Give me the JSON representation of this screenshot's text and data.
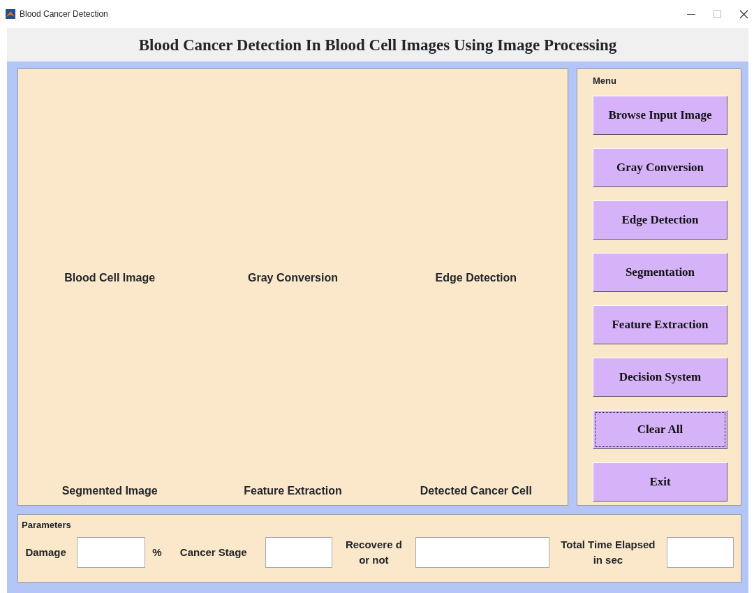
{
  "window": {
    "title": "Blood Cancer Detection"
  },
  "heading": "Blood Cancer Detection In Blood Cell Images Using Image Processing",
  "image_labels": [
    {
      "label": "Blood Cell Image"
    },
    {
      "label": "Gray Conversion"
    },
    {
      "label": "Edge Detection"
    },
    {
      "label": "Segmented Image"
    },
    {
      "label": "Feature Extraction"
    },
    {
      "label": "Detected Cancer Cell"
    }
  ],
  "menu": {
    "title": "Menu",
    "buttons": [
      {
        "label": "Browse Input Image",
        "focused": false
      },
      {
        "label": "Gray Conversion",
        "focused": false
      },
      {
        "label": "Edge Detection",
        "focused": false
      },
      {
        "label": "Segmentation",
        "focused": false
      },
      {
        "label": "Feature Extraction",
        "focused": false
      },
      {
        "label": "Decision System",
        "focused": false
      },
      {
        "label": "Clear All",
        "focused": true
      },
      {
        "label": "Exit",
        "focused": false
      }
    ]
  },
  "parameters": {
    "title": "Parameters",
    "fields": [
      {
        "label": "Damage",
        "unit": "%"
      },
      {
        "label": "Cancer Stage"
      },
      {
        "label": "Recovere d or not"
      },
      {
        "label": "Total Time Elapsed in sec"
      }
    ]
  }
}
